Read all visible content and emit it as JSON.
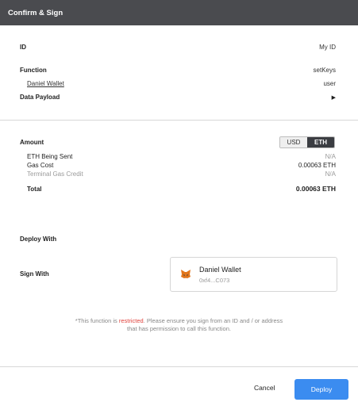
{
  "title": "Confirm & Sign",
  "info": {
    "id_label": "ID",
    "id_value": "My ID",
    "function_label": "Function",
    "function_value": "setKeys",
    "wallet_link": "Daniel Wallet",
    "wallet_value": "user",
    "payload_label": "Data Payload"
  },
  "amount": {
    "label": "Amount",
    "toggle": [
      "USD",
      "ETH"
    ],
    "selected": "ETH",
    "eth_sent_label": "ETH Being Sent",
    "eth_sent_value": "N/A",
    "gas_cost_label": "Gas Cost",
    "gas_cost_value": "0.00063 ETH",
    "terminal_gas_label": "Terminal Gas Credit",
    "terminal_gas_value": "N/A",
    "total_label": "Total",
    "total_value": "0.00063 ETH"
  },
  "deploy_with_label": "Deploy With",
  "sign_with": {
    "label": "Sign With",
    "wallet_name": "Daniel Wallet",
    "wallet_address": "0xf4...C073"
  },
  "notice": {
    "prefix": "*This function is ",
    "restricted": "restricted",
    "suffix_line1": ". Please ensure you sign from an ID and / or address",
    "line2": "that has permission to call this function."
  },
  "actions": {
    "cancel": "Cancel",
    "deploy": "Deploy"
  }
}
